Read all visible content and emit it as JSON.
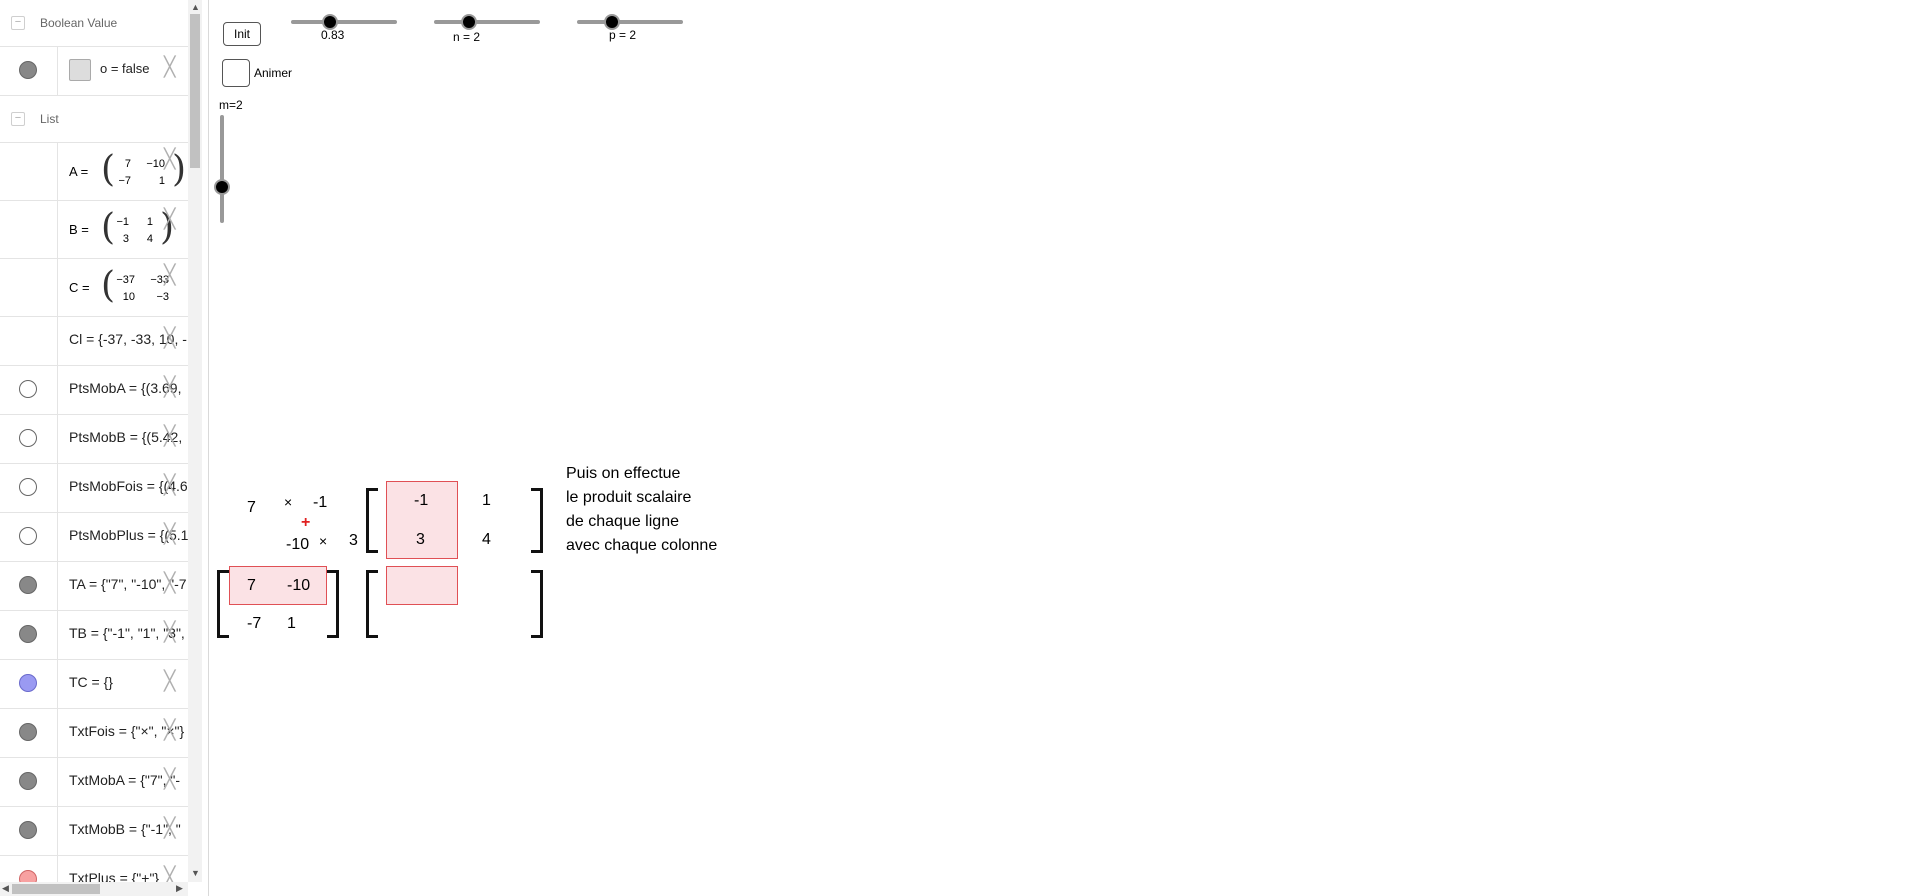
{
  "algebra": {
    "boolean_header": "Boolean Value",
    "boolean_item": "o = false",
    "list_header": "List",
    "matrix_A": {
      "name": "A =",
      "cells": [
        "7",
        "−10",
        "−7",
        "1"
      ]
    },
    "matrix_B": {
      "name": "B =",
      "cells": [
        "−1",
        "1",
        "3",
        "4"
      ]
    },
    "matrix_C": {
      "name": "C =",
      "cells": [
        "−37",
        "−33",
        "10",
        "−3"
      ]
    },
    "items": [
      "Cl = {-37, -33, 10, -",
      "PtsMobA = {(3.69,",
      "PtsMobB = {(5.42,",
      "PtsMobFois = {(4.6",
      "PtsMobPlus = {(5.1",
      "TA = {\"7\", \"-10\", \"-7",
      "TB = {\"-1\", \"1\", \"3\",",
      "TC = {}",
      "TxtFois = {\"×\", \"×\"}",
      "TxtMobA = {\"7\", \"-",
      "TxtMobB = {\"-1\", \"",
      "TxtPlus = {\"+\"}"
    ],
    "delete_glyph": "╳"
  },
  "controls": {
    "init_label": "Init",
    "slider1_label": "0.83",
    "slider1_value": 0.37,
    "slider2_label": "n = 2",
    "slider2_value": 0.33,
    "slider3_label": "p = 2",
    "slider3_value": 0.33,
    "animate_label": "Animer",
    "m_label": "m=2",
    "m_value": 0.33
  },
  "scene": {
    "a11": "7",
    "times1": "×",
    "b11_moving": "-1",
    "plus": "+",
    "a12_moving": "-10",
    "times2": "×",
    "b21_moving": "3",
    "B": [
      "-1",
      "1",
      "3",
      "4"
    ],
    "A": [
      "7",
      "-10",
      "-7",
      "1"
    ],
    "explanation": [
      "Puis on effectue",
      "le produit scalaire",
      "de chaque ligne",
      "avec chaque colonne"
    ]
  },
  "colors": {
    "highlight_fill": "#fbe2e5",
    "highlight_border": "#e05055",
    "plus_color": "#e02020"
  }
}
